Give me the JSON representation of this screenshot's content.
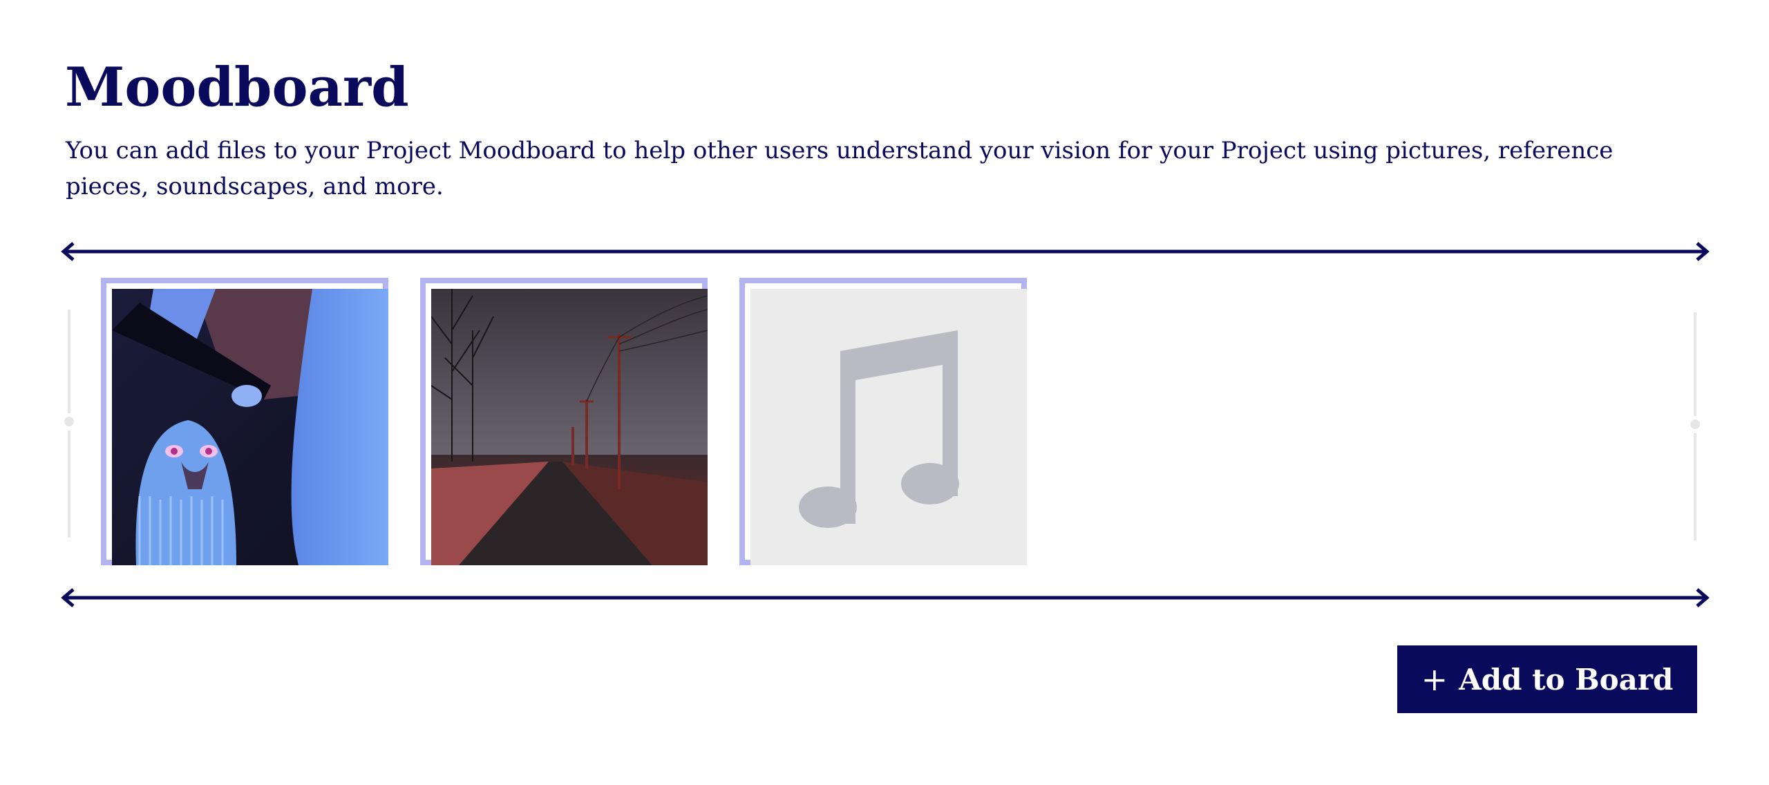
{
  "page": {
    "title": "Moodboard",
    "description": "You can add files to your Project Moodboard to help other users understand your vision for your Project using pictures, reference pieces, soundscapes, and more."
  },
  "moodboard": {
    "items": [
      {
        "kind": "image",
        "icon": "illustration-image"
      },
      {
        "kind": "image",
        "icon": "road-photo-image"
      },
      {
        "kind": "audio",
        "icon": "music-note-icon"
      }
    ]
  },
  "actions": {
    "add_icon": "+",
    "add_label": "Add to Board"
  },
  "colors": {
    "primary": "#090a5c",
    "tile_border": "#b2b3ef",
    "audio_bg": "#ebebeb",
    "audio_icon": "#babac2"
  }
}
